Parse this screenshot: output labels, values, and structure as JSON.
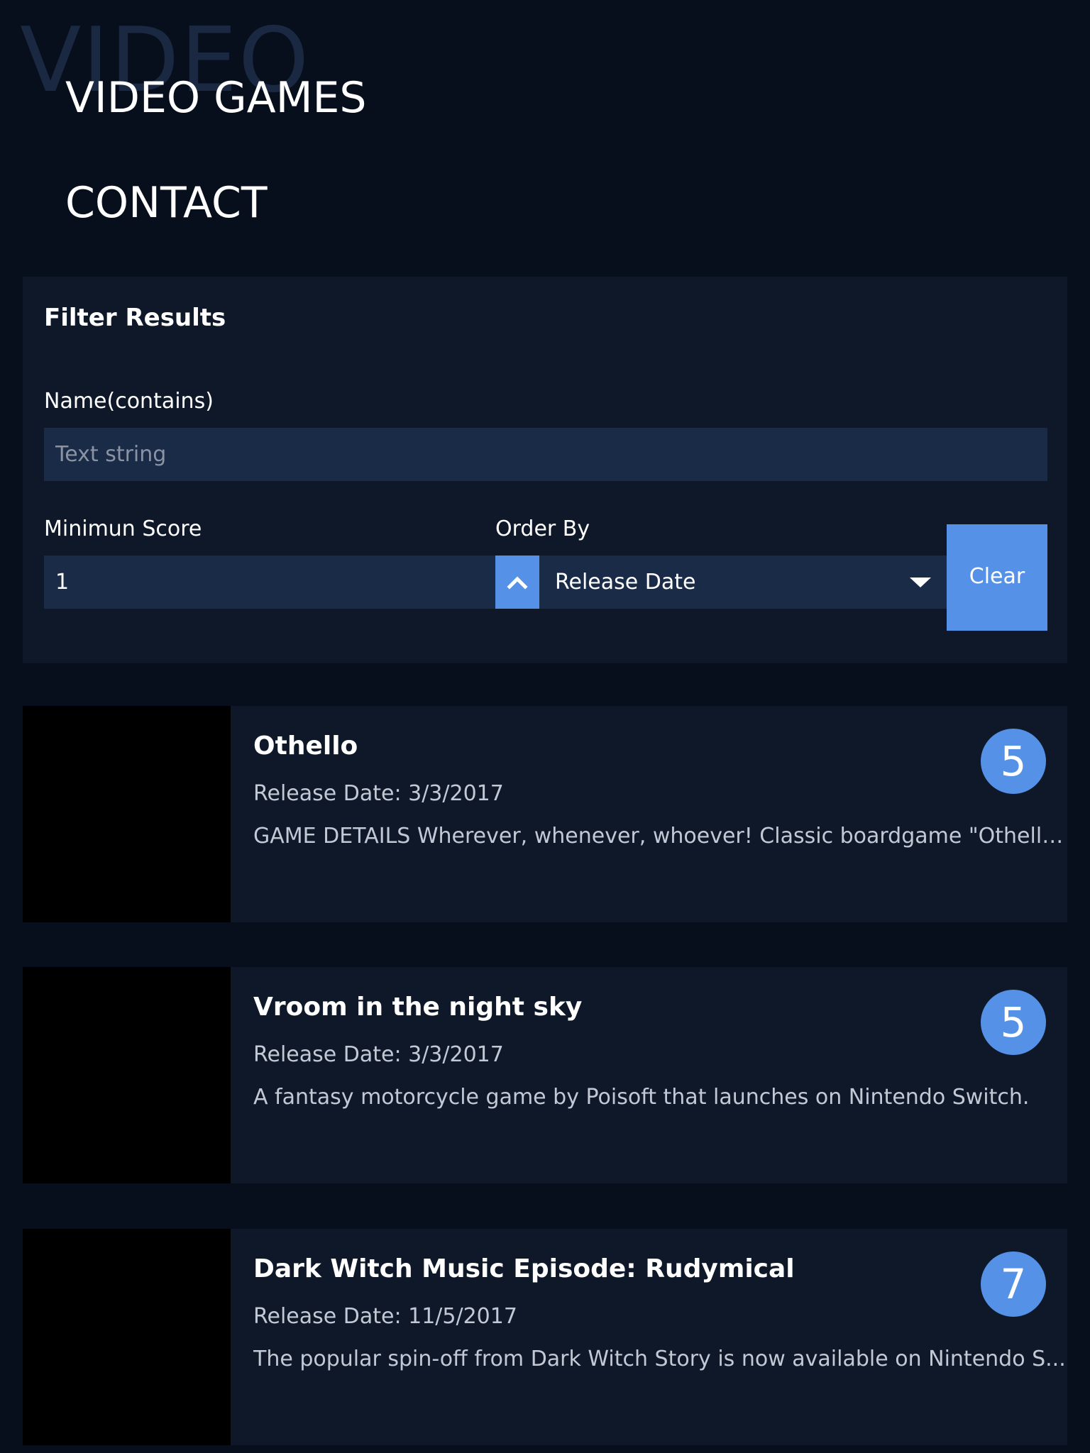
{
  "header": {
    "watermark": "VIDEO",
    "nav": [
      {
        "label": "VIDEO GAMES"
      },
      {
        "label": "CONTACT"
      }
    ]
  },
  "filter": {
    "title": "Filter Results",
    "name_label": "Name(contains)",
    "name_placeholder": "Text string",
    "name_value": "",
    "score_label": "Minimun Score",
    "score_value": "1",
    "order_label": "Order By",
    "order_selected": "Release Date",
    "order_direction_icon": "chevron-up-icon",
    "clear_label": "Clear"
  },
  "games": [
    {
      "title": "Othello",
      "date": "Release Date: 3/3/2017",
      "description": "GAME DETAILS Wherever, whenever, whoever! Classic boardgame \"Othello\"!...",
      "score": "5"
    },
    {
      "title": "Vroom in the night sky",
      "date": "Release Date: 3/3/2017",
      "description": "A fantasy motorcycle game by Poisoft that launches on Nintendo Switch.",
      "score": "5"
    },
    {
      "title": "Dark Witch Music Episode: Rudymical",
      "date": "Release Date: 11/5/2017",
      "description": "The popular spin-off from Dark Witch Story is now available on Nintendo S...",
      "score": "7"
    }
  ],
  "colors": {
    "background": "#080f1c",
    "panel": "#0e1829",
    "input": "#1a2b48",
    "accent": "#5591e6"
  }
}
